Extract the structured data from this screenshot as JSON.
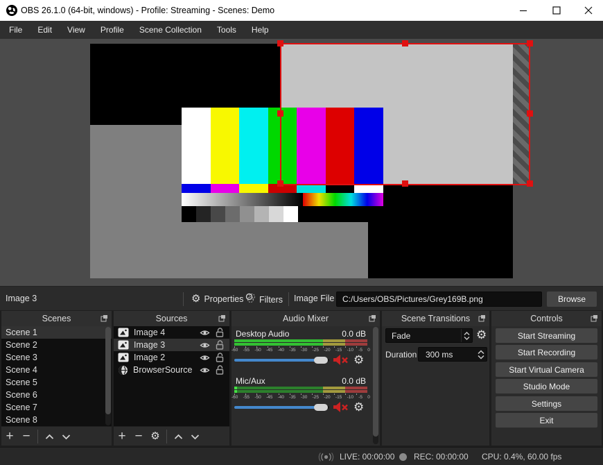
{
  "window": {
    "title": "OBS 26.1.0 (64-bit, windows) - Profile: Streaming - Scenes: Demo"
  },
  "menu": {
    "items": [
      "File",
      "Edit",
      "View",
      "Profile",
      "Scene Collection",
      "Tools",
      "Help"
    ]
  },
  "source_toolbar": {
    "source_name": "Image 3",
    "properties_label": "Properties",
    "filters_label": "Filters",
    "image_file_label": "Image File",
    "image_file_path": "C:/Users/OBS/Pictures/Grey169B.png",
    "browse_label": "Browse"
  },
  "panels": {
    "scenes": {
      "title": "Scenes",
      "items": [
        "Scene 1",
        "Scene 2",
        "Scene 3",
        "Scene 4",
        "Scene 5",
        "Scene 6",
        "Scene 7",
        "Scene 8"
      ],
      "selected": "Scene 1"
    },
    "sources": {
      "title": "Sources",
      "rows": [
        {
          "name": "Image 4",
          "icon": "image-icon"
        },
        {
          "name": "Image 3",
          "icon": "image-icon",
          "selected": true
        },
        {
          "name": "Image 2",
          "icon": "image-icon"
        },
        {
          "name": "BrowserSource",
          "icon": "globe-icon"
        }
      ]
    },
    "audio_mixer": {
      "title": "Audio Mixer",
      "ticks": [
        "-60",
        "-55",
        "-50",
        "-45",
        "-40",
        "-35",
        "-30",
        "-25",
        "-20",
        "-15",
        "-10",
        "-5",
        "0"
      ],
      "channels": [
        {
          "name": "Desktop Audio",
          "level_db": "0.0 dB",
          "muted": true
        },
        {
          "name": "Mic/Aux",
          "level_db": "0.0 dB",
          "muted": true
        }
      ]
    },
    "scene_transitions": {
      "title": "Scene Transitions",
      "transition": "Fade",
      "duration_label": "Duration",
      "duration_value": "300 ms"
    },
    "controls": {
      "title": "Controls",
      "buttons": [
        "Start Streaming",
        "Start Recording",
        "Start Virtual Camera",
        "Studio Mode",
        "Settings",
        "Exit"
      ]
    }
  },
  "status_bar": {
    "live": "LIVE: 00:00:00",
    "rec": "REC: 00:00:00",
    "stats": "CPU: 0.4%, 60.00 fps"
  },
  "colors": {
    "selection_red": "#e01010",
    "slider_blue": "#4488cc",
    "meter_green_active": "#33c133",
    "meter_green_dim": "#2c802c",
    "meter_yellow": "#a39a3d",
    "meter_red": "#9e3c3c",
    "mute_red": "#cc2222"
  }
}
